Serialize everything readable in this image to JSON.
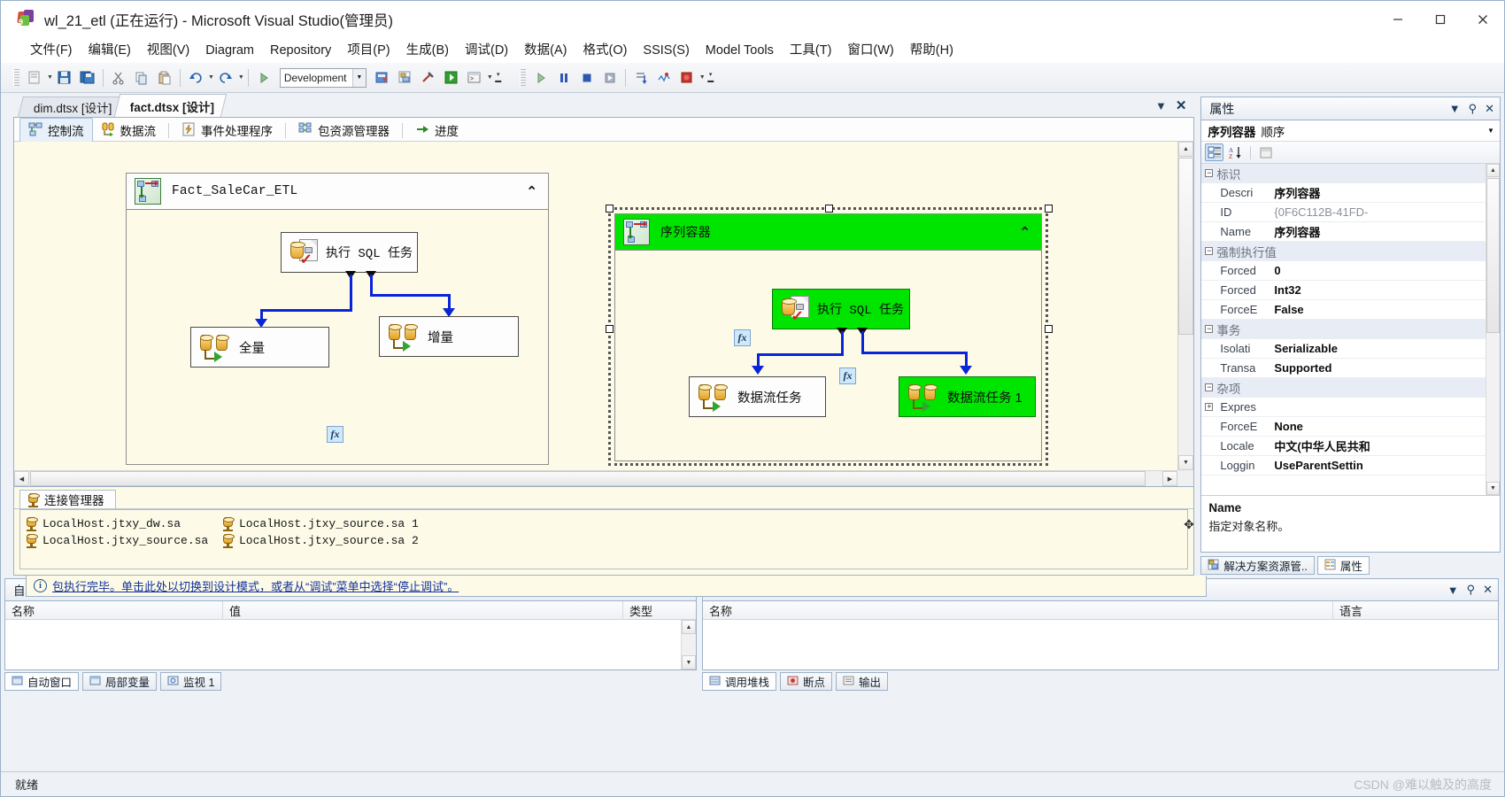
{
  "window": {
    "title": "wl_21_etl (正在运行) - Microsoft Visual Studio(管理员)",
    "minimize": "−",
    "maximize": "☐",
    "close": "✕"
  },
  "menubar": [
    {
      "label": "文件(F)"
    },
    {
      "label": "编辑(E)"
    },
    {
      "label": "视图(V)"
    },
    {
      "label": "Diagram"
    },
    {
      "label": "Repository"
    },
    {
      "label": "项目(P)"
    },
    {
      "label": "生成(B)"
    },
    {
      "label": "调试(D)"
    },
    {
      "label": "数据(A)"
    },
    {
      "label": "格式(O)"
    },
    {
      "label": "SSIS(S)"
    },
    {
      "label": "Model Tools"
    },
    {
      "label": "工具(T)"
    },
    {
      "label": "窗口(W)"
    },
    {
      "label": "帮助(H)"
    }
  ],
  "toolbar": {
    "config_value": "Development",
    "config_placeholder": "Development"
  },
  "doc_tabs": [
    {
      "label": "dim.dtsx [设计]",
      "active": false
    },
    {
      "label": "fact.dtsx [设计]",
      "active": true
    }
  ],
  "view_tabs": [
    {
      "label": "控制流",
      "icon": "control-flow-icon",
      "selected": true
    },
    {
      "label": "数据流",
      "icon": "data-flow-icon",
      "selected": false
    },
    {
      "label": "事件处理程序",
      "icon": "event-handler-icon",
      "selected": false
    },
    {
      "label": "包资源管理器",
      "icon": "package-explorer-icon",
      "selected": false
    },
    {
      "label": "进度",
      "icon": "progress-icon",
      "selected": false
    }
  ],
  "canvas": {
    "container_left": {
      "title": "Fact_SaleCar_ETL",
      "collapse_glyph": "⌃"
    },
    "container_right": {
      "title": "序列容器",
      "collapse_glyph": "⌃"
    },
    "nodes": [
      {
        "id": "left-sql",
        "label": "执行 SQL 任务",
        "state": "idle"
      },
      {
        "id": "left-full",
        "label": "全量",
        "state": "idle"
      },
      {
        "id": "left-incr",
        "label": "增量",
        "state": "idle"
      },
      {
        "id": "right-sql",
        "label": "执行 SQL 任务",
        "state": "success"
      },
      {
        "id": "right-df",
        "label": "数据流任务",
        "state": "idle"
      },
      {
        "id": "right-df1",
        "label": "数据流任务 1",
        "state": "success"
      }
    ],
    "fx_label": "fx"
  },
  "connection_manager": {
    "tab_label": "连接管理器",
    "items": [
      "LocalHost.jtxy_dw.sa",
      "LocalHost.jtxy_source.sa 1",
      "LocalHost.jtxy_source.sa",
      "LocalHost.jtxy_source.sa 2"
    ]
  },
  "status_message": "包执行完毕。单击此处以切换到设计模式，或者从“调试”菜单中选择“停止调试”。",
  "properties": {
    "panel_title": "属性",
    "object_type": "序列容器",
    "object_subtype": "顺序",
    "rows": [
      {
        "kind": "category",
        "name": "标识",
        "expander": "−"
      },
      {
        "kind": "prop",
        "key": "Descri",
        "value": "序列容器",
        "dim": false
      },
      {
        "kind": "prop",
        "key": "ID",
        "value": "{0F6C112B-41FD-",
        "dim": true
      },
      {
        "kind": "prop",
        "key": "Name",
        "value": "序列容器",
        "dim": false
      },
      {
        "kind": "category",
        "name": "强制执行值",
        "expander": "−"
      },
      {
        "kind": "prop",
        "key": "Forced",
        "value": "0",
        "dim": false
      },
      {
        "kind": "prop",
        "key": "Forced",
        "value": "Int32",
        "dim": false
      },
      {
        "kind": "prop",
        "key": "ForceE",
        "value": "False",
        "dim": false
      },
      {
        "kind": "category",
        "name": "事务",
        "expander": "−"
      },
      {
        "kind": "prop",
        "key": "Isolati",
        "value": "Serializable",
        "dim": false
      },
      {
        "kind": "prop",
        "key": "Transa",
        "value": "Supported",
        "dim": false
      },
      {
        "kind": "category",
        "name": "杂项",
        "expander": "−"
      },
      {
        "kind": "prop",
        "key": "Expres",
        "value": "",
        "dim": false,
        "expander": "+"
      },
      {
        "kind": "prop",
        "key": "ForceE",
        "value": "None",
        "dim": false
      },
      {
        "kind": "prop",
        "key": "Locale",
        "value": "中文(中华人民共和",
        "dim": false
      },
      {
        "kind": "prop",
        "key": "Loggin",
        "value": "UseParentSettin",
        "dim": false
      }
    ],
    "description_title": "Name",
    "description_text": "指定对象名称。",
    "bottom_tabs": [
      {
        "label": "解决方案资源管..",
        "icon": "solution-explorer-icon",
        "selected": false
      },
      {
        "label": "属性",
        "icon": "properties-icon",
        "selected": true
      }
    ]
  },
  "autos_panel": {
    "title": "自动窗口",
    "columns": [
      "名称",
      "值",
      "类型"
    ],
    "tabs": [
      {
        "label": "自动窗口",
        "selected": true
      },
      {
        "label": "局部变量",
        "selected": false
      },
      {
        "label": "监视 1",
        "selected": false
      }
    ]
  },
  "callstack_panel": {
    "title": "调用堆栈",
    "columns": [
      "名称",
      "语言"
    ],
    "tabs": [
      {
        "label": "调用堆栈",
        "selected": true
      },
      {
        "label": "断点",
        "selected": false
      },
      {
        "label": "输出",
        "selected": false
      }
    ]
  },
  "statusbar": {
    "text": "就绪",
    "watermark": "CSDN @难以触及的高度"
  }
}
